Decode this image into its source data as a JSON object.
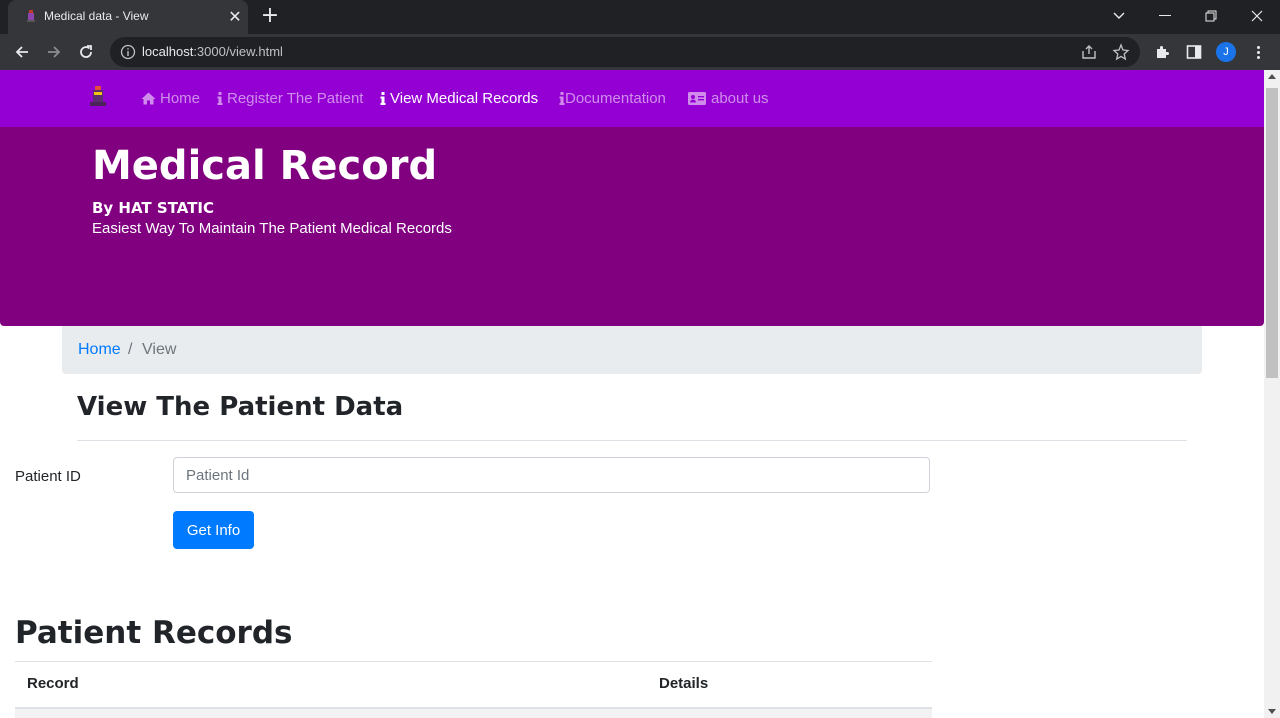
{
  "browser": {
    "tab_title": "Medical data - View",
    "url_host": "localhost",
    "url_rest": ":3000/view.html",
    "avatar_letter": "J"
  },
  "navbar": {
    "items": [
      {
        "icon": "home-icon",
        "label": "Home",
        "active": false
      },
      {
        "icon": "info-icon",
        "label": "Register The Patient",
        "active": false
      },
      {
        "icon": "info-icon",
        "label": "View Medical Records",
        "active": true
      },
      {
        "icon": "info-icon",
        "label": "Documentation",
        "active": false
      },
      {
        "icon": "id-card-icon",
        "label": "about us",
        "active": false
      }
    ],
    "background": "#9400d3"
  },
  "jumbotron": {
    "title": "Medical Record",
    "byline": "By HAT STATIC",
    "subtitle": "Easiest Way To Maintain The Patient Medical Records",
    "background": "#800080"
  },
  "breadcrumb": {
    "home": "Home",
    "separator": "/",
    "current": "View"
  },
  "form": {
    "heading": "View The Patient Data",
    "patient_id_label": "Patient ID",
    "patient_id_placeholder": "Patient Id",
    "patient_id_value": "",
    "submit_label": "Get Info",
    "submit_color": "#007bff"
  },
  "records": {
    "heading": "Patient Records",
    "columns": [
      "Record",
      "Details"
    ],
    "rows": []
  }
}
